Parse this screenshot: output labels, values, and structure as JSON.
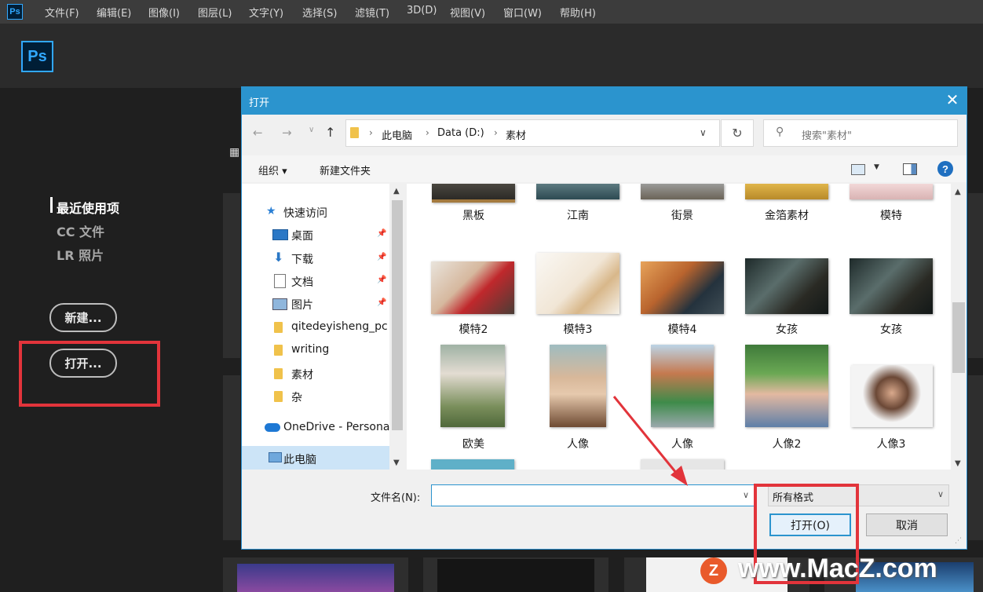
{
  "app": {
    "logo": "Ps",
    "menu": [
      "文件(F)",
      "编辑(E)",
      "图像(I)",
      "图层(L)",
      "文字(Y)",
      "选择(S)",
      "滤镜(T)",
      "3D(D)",
      "视图(V)",
      "窗口(W)",
      "帮助(H)"
    ]
  },
  "home": {
    "sidebar": [
      "最近使用项",
      "CC 文件",
      "LR 照片"
    ],
    "new_button": "新建...",
    "open_button": "打开..."
  },
  "dialog": {
    "title": "打开",
    "breadcrumb": [
      "此电脑",
      "Data (D:)",
      "素材"
    ],
    "search_placeholder": "搜索\"素材\"",
    "toolbar": {
      "organize": "组织 ▾",
      "new_folder": "新建文件夹"
    },
    "nav": [
      {
        "label": "快速访问",
        "icon": "star-icon"
      },
      {
        "label": "桌面",
        "icon": "desktop-icon",
        "pinned": true
      },
      {
        "label": "下载",
        "icon": "download-icon",
        "pinned": true
      },
      {
        "label": "文档",
        "icon": "document-icon",
        "pinned": true
      },
      {
        "label": "图片",
        "icon": "picture-icon",
        "pinned": true
      },
      {
        "label": "qitedeyisheng_pc",
        "icon": "folder-icon"
      },
      {
        "label": "writing",
        "icon": "folder-icon"
      },
      {
        "label": "素材",
        "icon": "folder-icon"
      },
      {
        "label": "杂",
        "icon": "folder-icon"
      },
      {
        "label": "OneDrive - Persona",
        "icon": "cloud-icon"
      },
      {
        "label": "此电脑",
        "icon": "computer-icon",
        "selected": true
      }
    ],
    "files": [
      "黑板",
      "江南",
      "街景",
      "金箔素材",
      "模特",
      "模特2",
      "模特3",
      "模特4",
      "女孩",
      "女孩",
      "欧美",
      "人像",
      "人像",
      "人像2",
      "人像3"
    ],
    "filename_label": "文件名(N):",
    "filename_value": "",
    "filter_value": "所有格式",
    "open_button": "打开(O)",
    "cancel_button": "取消"
  },
  "watermark": {
    "text": "www.MacZ.com",
    "logo_letter": "Z"
  },
  "colors": {
    "accent": "#2b94ce",
    "annotation": "#e2343b",
    "ps_blue": "#31a8ff"
  }
}
